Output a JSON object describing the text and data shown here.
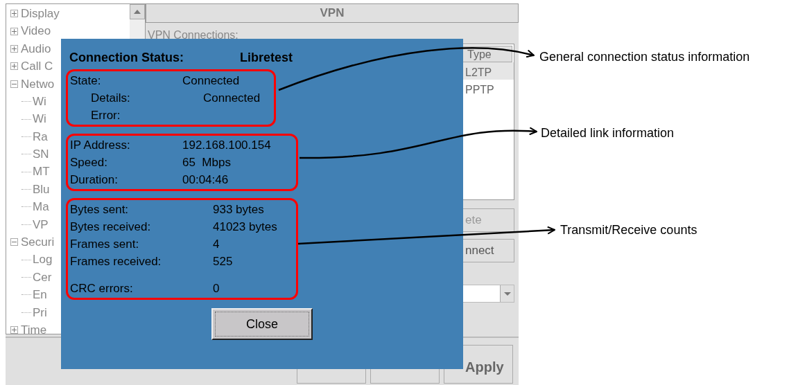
{
  "tree": [
    {
      "label": "Display",
      "expanded": false
    },
    {
      "label": "Video",
      "expanded": false
    },
    {
      "label": "Audio",
      "expanded": false
    },
    {
      "label": "Call C",
      "expanded": false
    },
    {
      "label": "Netwo",
      "expanded": true,
      "children": [
        {
          "label": "Wi"
        },
        {
          "label": "Wi"
        },
        {
          "label": "Ra"
        },
        {
          "label": "SN"
        },
        {
          "label": "MT"
        },
        {
          "label": "Blu"
        },
        {
          "label": "Ma"
        },
        {
          "label": "VP"
        }
      ]
    },
    {
      "label": "Securi",
      "expanded": true,
      "children": [
        {
          "label": "Log"
        },
        {
          "label": "Cer"
        },
        {
          "label": "En"
        },
        {
          "label": "Pri"
        }
      ]
    },
    {
      "label": "Time",
      "expanded": false
    }
  ],
  "panel": {
    "title": "VPN",
    "connections_label": "VPN Connections:",
    "list": {
      "column": "Type",
      "rows": [
        "L2TP",
        "PPTP"
      ]
    },
    "buttons": [
      {
        "label": "ete",
        "disabled": true
      },
      {
        "label": "nnect",
        "disabled": false
      }
    ],
    "apply_button": "Apply"
  },
  "dialog": {
    "title": "Connection Status:",
    "name": "Libretest",
    "groups": [
      {
        "rows": [
          {
            "label": "State:",
            "value": "Connected",
            "indent": false
          },
          {
            "label": "Details:",
            "value": "Connected",
            "indent": true
          },
          {
            "label": "Error:",
            "value": "",
            "indent": true
          }
        ]
      },
      {
        "rows": [
          {
            "label": "IP Address:",
            "value": "192.168.100.154"
          },
          {
            "label": "Speed:",
            "value": "65  Mbps"
          },
          {
            "label": "Duration:",
            "value": "00:04:46"
          }
        ]
      },
      {
        "rows": [
          {
            "label": "Bytes sent:",
            "value": "933 bytes"
          },
          {
            "label": "Bytes received:",
            "value": "41023 bytes"
          },
          {
            "label": "Frames sent:",
            "value": "4"
          },
          {
            "label": "Frames received:",
            "value": "525"
          },
          {
            "label": "CRC errors:",
            "value": "0"
          }
        ]
      }
    ],
    "close": "Close"
  },
  "annotations": [
    "General connection status information",
    "Detailed link information",
    "Transmit/Receive counts"
  ]
}
